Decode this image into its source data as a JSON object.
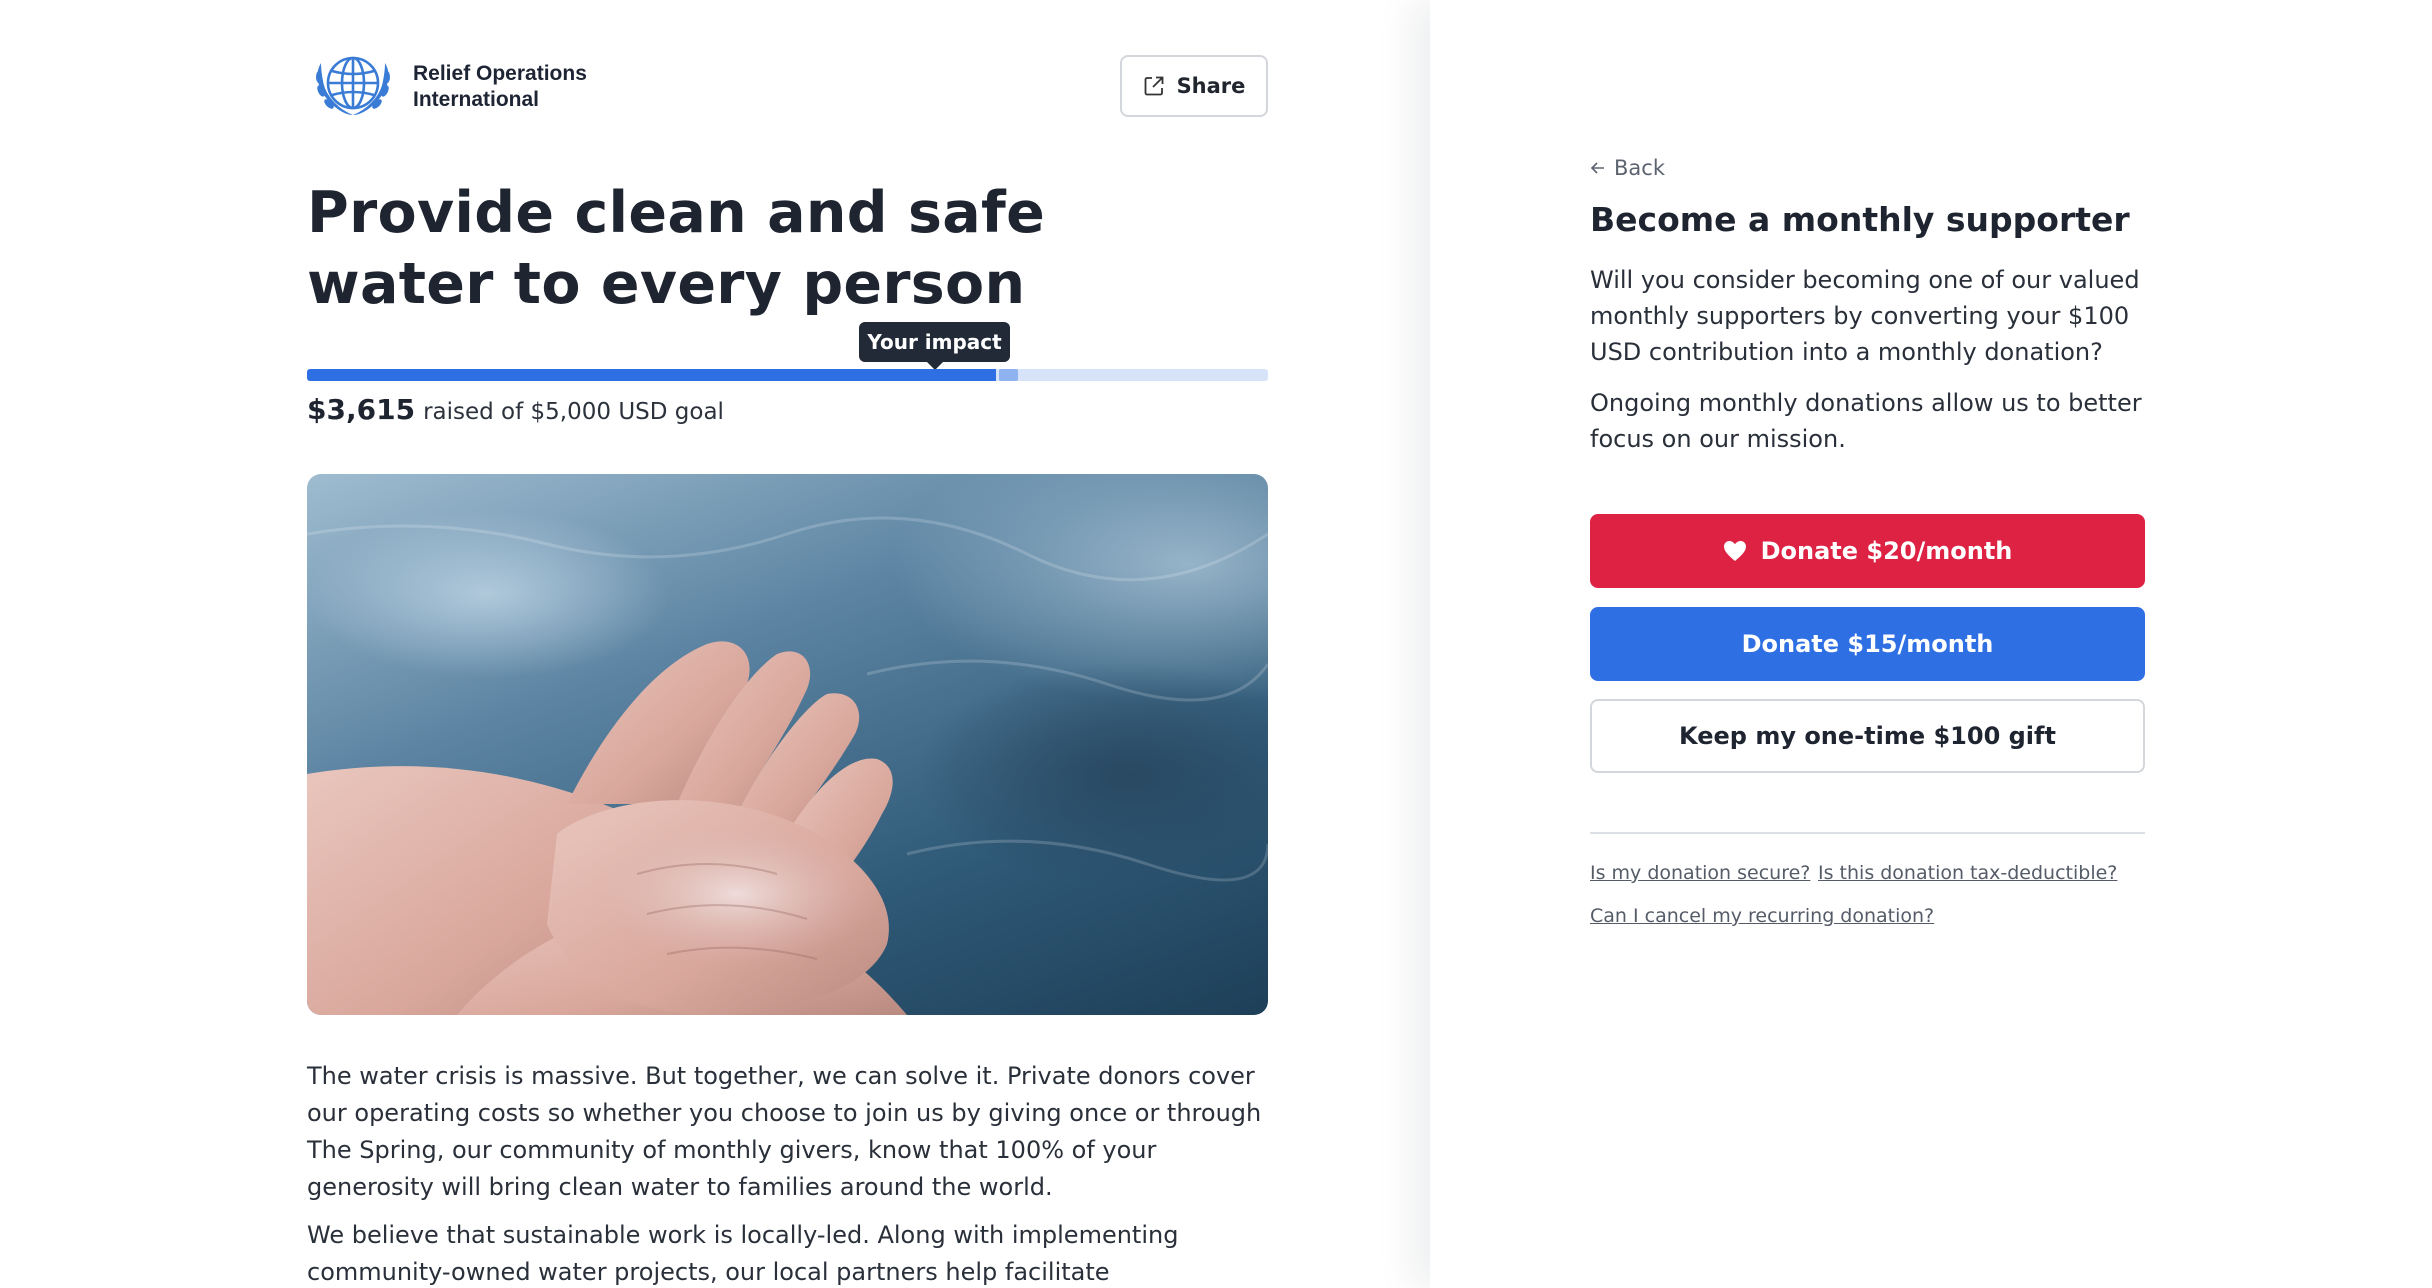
{
  "org": {
    "name": "Relief Operations International"
  },
  "header": {
    "share_label": "Share"
  },
  "campaign": {
    "headline": "Provide clean and safe water to every person",
    "tooltip": "Your impact",
    "raised_amount": "$3,615",
    "raised_text": "raised of $5,000 USD goal",
    "progress": {
      "raised_fraction": 0.723,
      "impact_fraction": 0.02
    },
    "body": [
      "The water crisis is massive. But together, we can solve it. Private donors cover our operating costs so whether you choose to join us by giving once or through The Spring, our community of monthly givers, know that 100% of your generosity will bring clean water to families around the world.",
      "We believe that sustainable work is locally-led. Along with implementing community-owned water projects, our local partners help facilitate comprehensive water,"
    ]
  },
  "modal": {
    "back_label": "Back",
    "title": "Become a monthly supporter",
    "paragraph1": "Will you consider becoming one of our valued monthly supporters by converting your $100 USD contribution into a monthly donation?",
    "paragraph2": "Ongoing monthly donations allow us to better focus on our mission.",
    "primary_button": "Donate $20/month",
    "secondary_button": "Donate $15/month",
    "tertiary_button": "Keep my one-time $100 gift",
    "faq": [
      "Is my donation secure?",
      "Is this donation tax-deductible?",
      "Can I cancel my recurring donation?"
    ]
  },
  "colors": {
    "primary_red": "#dd2243",
    "primary_blue": "#2f6fe4",
    "progress_track": "#d6e3f8",
    "tooltip_bg": "#222a38"
  },
  "icons": [
    "globe-laurel-logo-icon",
    "share-icon",
    "arrow-left-icon",
    "heart-icon"
  ]
}
